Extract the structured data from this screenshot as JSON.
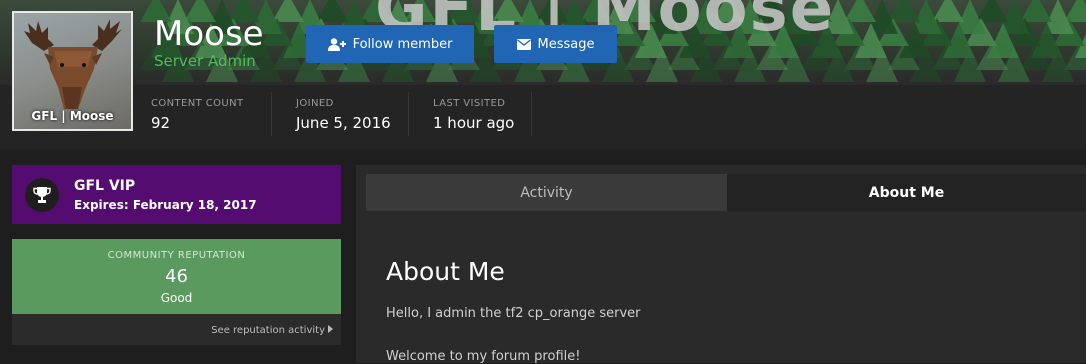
{
  "profile": {
    "username": "Moose",
    "group": "Server Admin",
    "avatar_brand": "GFL | Moose",
    "cover_text": "GFL | Moose"
  },
  "actions": {
    "follow_label": "Follow member",
    "follow_icon": "user-plus-icon",
    "message_label": "Message",
    "message_icon": "envelope-icon"
  },
  "stats": [
    {
      "label": "Content Count",
      "value": "92"
    },
    {
      "label": "Joined",
      "value": "June 5, 2016"
    },
    {
      "label": "Last Visited",
      "value": "1 hour ago"
    }
  ],
  "vip": {
    "title": "GFL VIP",
    "expires": "Expires: February 18, 2017",
    "icon": "trophy-icon",
    "color": "#540c70"
  },
  "reputation": {
    "title": "COMMUNITY REPUTATION",
    "count": "46",
    "status": "Good",
    "link": "See reputation activity",
    "color": "#5a9a5e"
  },
  "tabs": [
    {
      "label": "Activity",
      "active": false
    },
    {
      "label": "About Me",
      "active": true
    }
  ],
  "about": {
    "heading": "About Me",
    "lines": [
      "Hello, I admin the tf2 cp_orange server",
      "Welcome to my forum profile!"
    ]
  },
  "colors": {
    "accent_button": "#2165b5",
    "group_green": "#4cbf5a"
  }
}
